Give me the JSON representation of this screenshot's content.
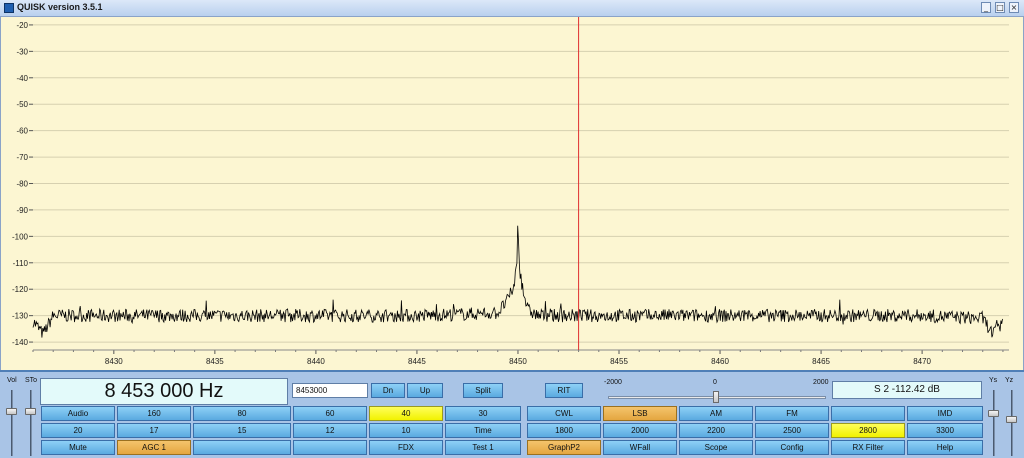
{
  "window": {
    "title": "QUISK version 3.5.1",
    "controls": [
      "_",
      "□",
      "×"
    ]
  },
  "graph": {
    "background": "#fcf6d2",
    "grid_color": "#d6d0b0",
    "trace_color": "#000000",
    "marker_color": "#e03030",
    "y_ticks": [
      "-20",
      "-30",
      "-40",
      "-50",
      "-60",
      "-70",
      "-80",
      "-90",
      "-100",
      "-110",
      "-120",
      "-130",
      "-140"
    ],
    "x_ticks": [
      "8430",
      "8435",
      "8440",
      "8445",
      "8450",
      "8455",
      "8460",
      "8465",
      "8470"
    ],
    "tuned_frequency_khz": 8453,
    "noise_floor_db": -130,
    "peak": {
      "frequency_khz": 8450,
      "level_db": -92
    }
  },
  "chart_data": {
    "type": "line",
    "xlabel": "",
    "ylabel": "",
    "xlim": [
      8426,
      8474.3
    ],
    "ylim": [
      -143,
      -17
    ],
    "x_ticks": [
      8430,
      8435,
      8440,
      8445,
      8450,
      8455,
      8460,
      8465,
      8470
    ],
    "y_ticks": [
      -20,
      -30,
      -40,
      -50,
      -60,
      -70,
      -80,
      -90,
      -100,
      -110,
      -120,
      -130,
      -140
    ],
    "grid": true,
    "series": [
      {
        "x": [
          8426.0,
          8426.5,
          8427,
          8430,
          8435,
          8440,
          8445,
          8449.0,
          8449.5,
          8449.8,
          8449.95,
          8450.0,
          8450.05,
          8450.2,
          8450.5,
          8451,
          8455,
          8460,
          8465,
          8470,
          8473.0,
          8473.5,
          8474.0
        ],
        "y": [
          -132,
          -137,
          -130,
          -130,
          -130,
          -130,
          -130,
          -129,
          -124,
          -119,
          -110,
          -92,
          -110,
          -119,
          -128,
          -130,
          -130,
          -130,
          -130,
          -130,
          -131,
          -137,
          -133
        ]
      }
    ],
    "markers": [
      {
        "x": 8453,
        "label": "tuned frequency"
      }
    ]
  },
  "controls": {
    "vol_label": "Vol",
    "sto_label": "STo",
    "ys_label": "Ys",
    "yz_label": "Yz",
    "frequency_display": "8 453 000 Hz",
    "frequency_entry": "8453000",
    "dn_label": "Dn",
    "up_label": "Up",
    "split_label": "Split",
    "rit_label": "RIT",
    "pan_min": "-2000",
    "pan_mid": "0",
    "pan_max": "2000",
    "smeter": "S 2   -112.42 dB"
  },
  "buttons": {
    "row1": [
      "Audio",
      "160",
      "80",
      "60",
      "40",
      "30",
      "CWL",
      "LSB",
      "AM",
      "FM",
      "",
      "IMD"
    ],
    "row2": [
      "20",
      "17",
      "15",
      "12",
      "10",
      "Time",
      "1800",
      "2000",
      "2200",
      "2500",
      "2800",
      "3300"
    ],
    "row3": [
      "Mute",
      "AGC 1",
      "",
      "",
      "FDX",
      "Test 1",
      "GraphP2",
      "WFall",
      "Scope",
      "Config",
      "RX Filter",
      "Help"
    ]
  },
  "colors": {
    "button_blue": "#6cbaec",
    "button_selected_yellow": "#ffff20",
    "button_selected_orange": "#eab050",
    "panel_bg": "#a9c4e6",
    "display_bg": "#e3fafa"
  }
}
